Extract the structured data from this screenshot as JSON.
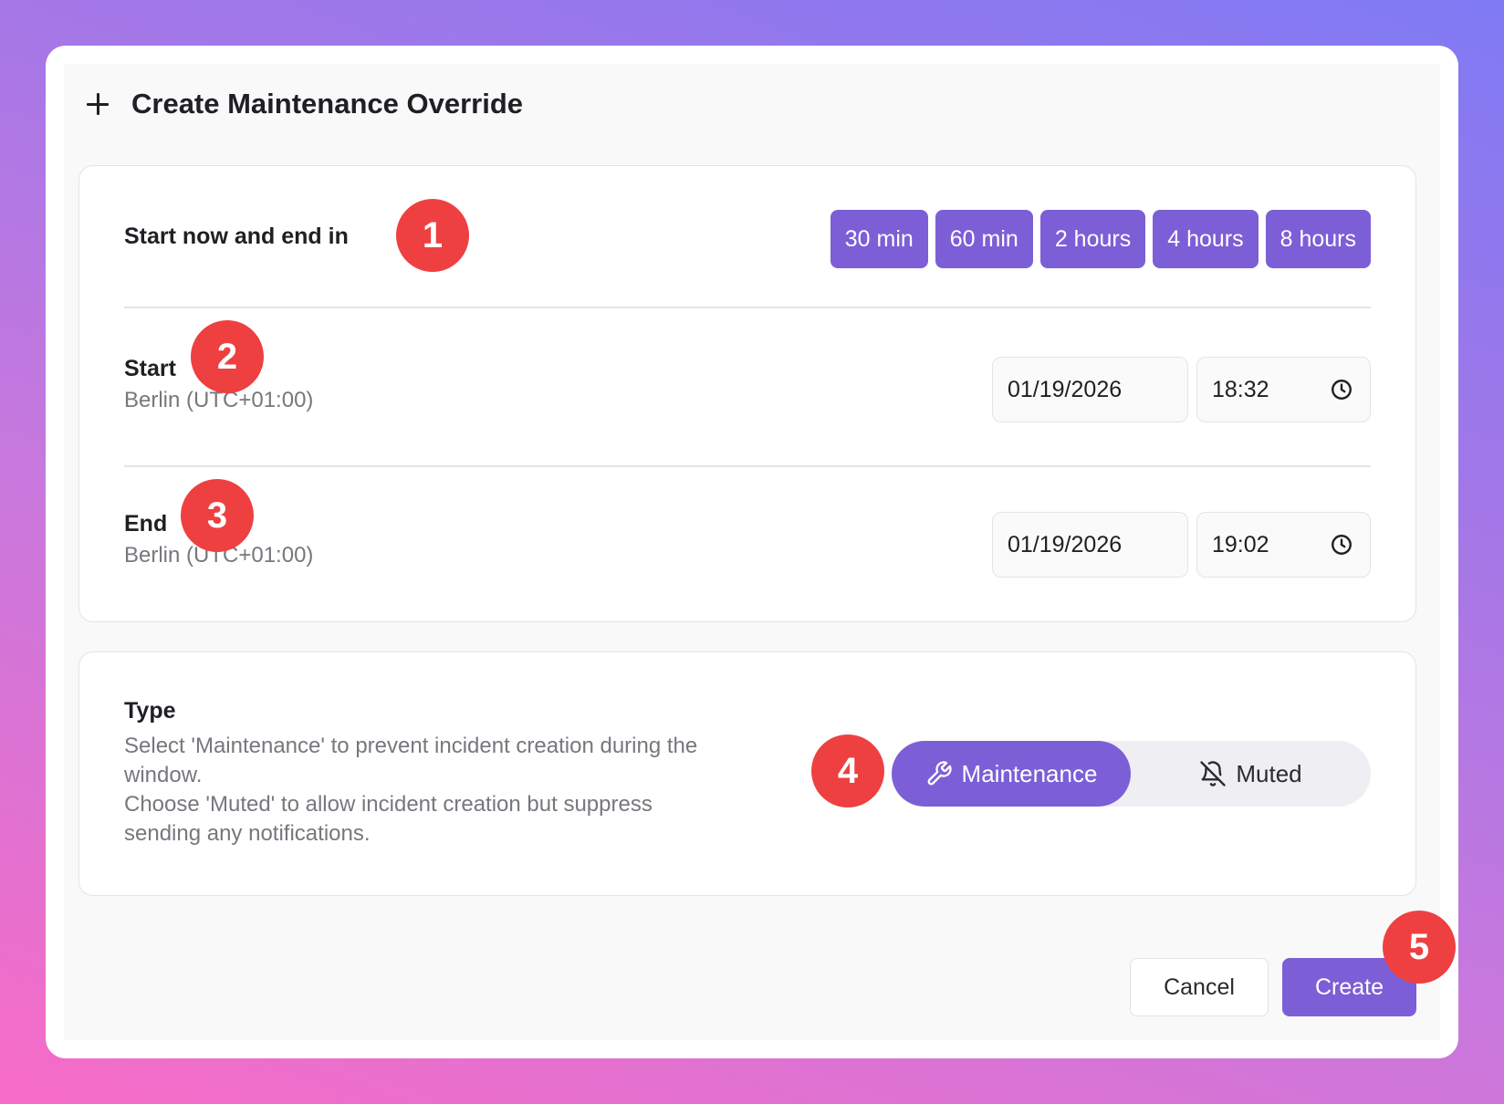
{
  "dialog": {
    "title": "Create Maintenance Override"
  },
  "quick": {
    "label": "Start now and end in",
    "presets": [
      "30 min",
      "60 min",
      "2 hours",
      "4 hours",
      "8 hours"
    ]
  },
  "start": {
    "label": "Start",
    "timezone": "Berlin (UTC+01:00)",
    "date": "01/19/2026",
    "time": "18:32"
  },
  "end": {
    "label": "End",
    "timezone": "Berlin (UTC+01:00)",
    "date": "01/19/2026",
    "time": "19:02"
  },
  "type": {
    "label": "Type",
    "description_line1": "Select 'Maintenance' to prevent incident creation during the window.",
    "description_line2": "Choose 'Muted' to allow incident creation but suppress sending any notifications.",
    "options": [
      "Maintenance",
      "Muted"
    ],
    "selected": "Maintenance"
  },
  "footer": {
    "cancel_label": "Cancel",
    "create_label": "Create"
  },
  "annotations": [
    "1",
    "2",
    "3",
    "4",
    "5"
  ],
  "icons": {
    "header": "plus-icon",
    "time": "clock-icon",
    "maintenance": "wrench-icon",
    "muted": "bell-off-icon"
  },
  "colors": {
    "accent": "#7c5fd6",
    "badge": "#ee4040"
  }
}
